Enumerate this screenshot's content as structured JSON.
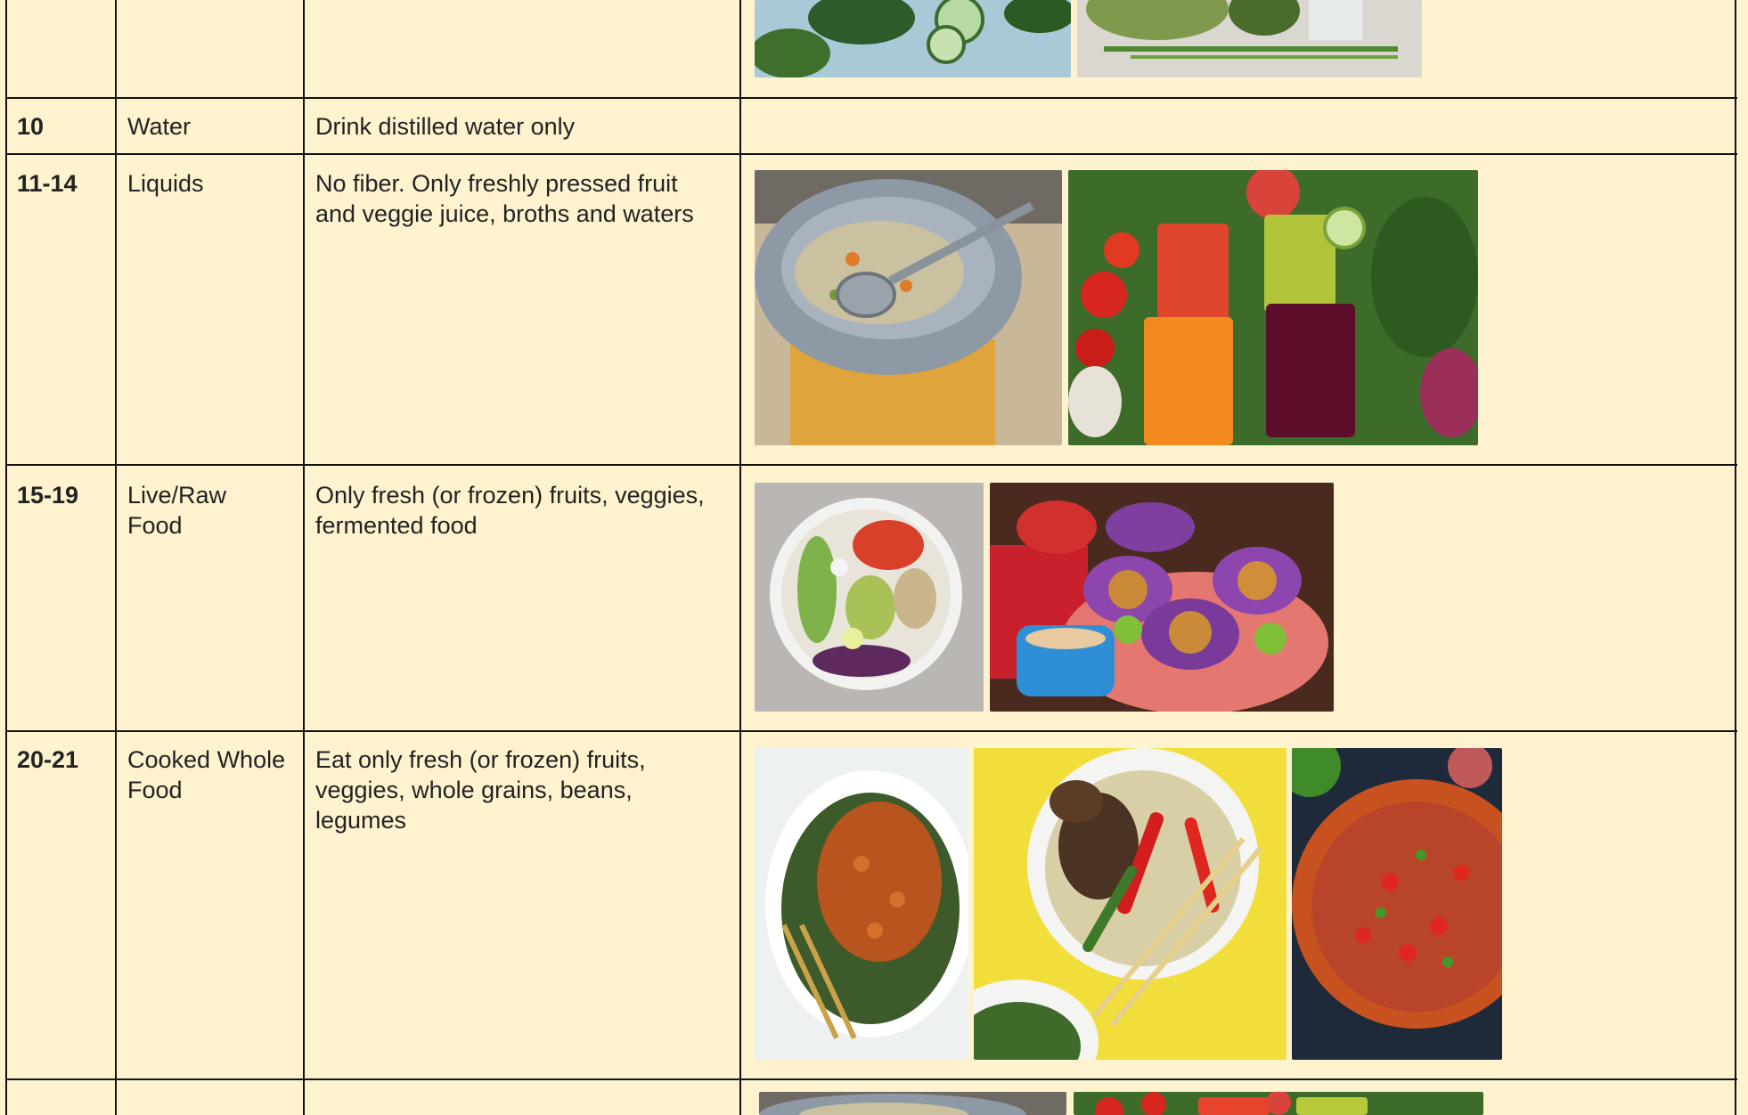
{
  "table": {
    "rows": [
      {
        "day": "",
        "phase": "",
        "description": "",
        "images": [
          "vegetables-image",
          "vegetables-image"
        ]
      },
      {
        "day": "10",
        "phase": "Water",
        "description": "Drink distilled water only",
        "images": []
      },
      {
        "day": "11-14",
        "phase": "Liquids",
        "description": "No fiber.  Only freshly pressed fruit\nand veggie juice, broths and waters",
        "images": [
          "vegetable-broth-strainer-image",
          "fresh-juices-image"
        ]
      },
      {
        "day": "15-19",
        "phase": "Live/Raw\nFood",
        "description": "Only fresh (or frozen) fruits, veggies,\nfermented food",
        "images": [
          "raw-veggie-bowl-image",
          "cabbage-lettuce-wraps-image"
        ]
      },
      {
        "day": "20-21",
        "phase": "Cooked Whole\nFood",
        "description": "Eat only fresh (or frozen) fruits,\nveggies, whole grains, beans,\nlegumes",
        "images": [
          "roasted-chickpea-kale-salad-image",
          "mushroom-pepper-stirfry-image",
          "vegetable-soup-image"
        ]
      },
      {
        "day": "",
        "phase": "",
        "description": "",
        "images": [
          "vegetable-broth-strainer-image",
          "fresh-juices-image"
        ]
      }
    ]
  },
  "colors": {
    "background": "#fff3cf",
    "grid": "#111111",
    "text": "#222222"
  }
}
